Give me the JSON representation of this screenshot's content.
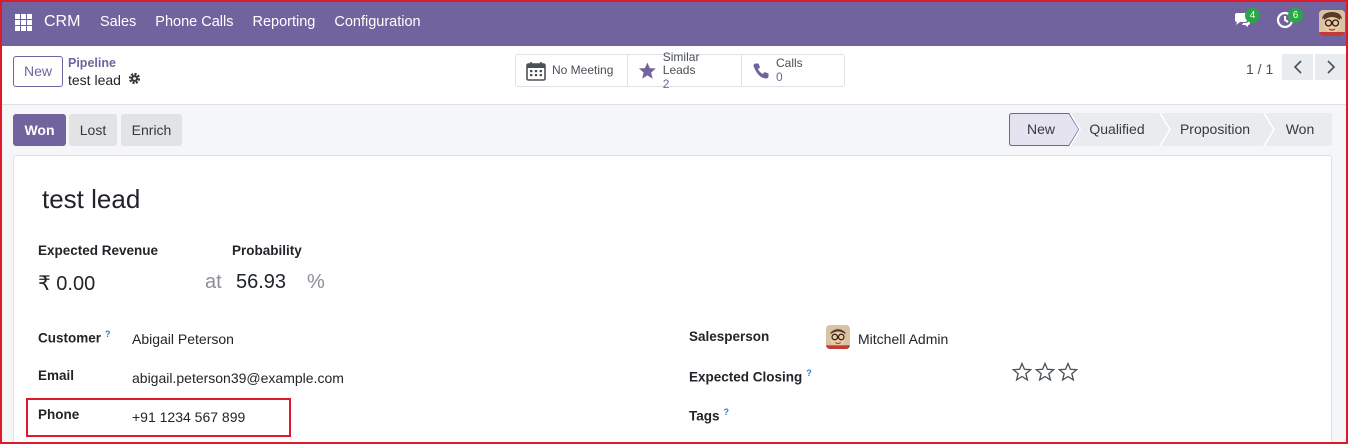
{
  "navbar": {
    "app_name": "CRM",
    "menu": [
      "Sales",
      "Phone Calls",
      "Reporting",
      "Configuration"
    ],
    "messages_badge": "4",
    "activities_badge": "6",
    "bg_color": "#71639e"
  },
  "control_panel": {
    "new_button": "New",
    "breadcrumb_parent": "Pipeline",
    "breadcrumb_current": "test lead",
    "smart_buttons": {
      "meeting": "No Meeting",
      "similar_label": "Similar Leads",
      "similar_count": "2",
      "calls_label": "Calls",
      "calls_count": "0"
    },
    "pager": "1 / 1"
  },
  "status_bar": {
    "actions": {
      "won": "Won",
      "lost": "Lost",
      "enrich": "Enrich"
    },
    "stages": [
      "New",
      "Qualified",
      "Proposition",
      "Won"
    ],
    "active_stage": "New"
  },
  "form": {
    "title": "test lead",
    "expected_revenue_label": "Expected Revenue",
    "expected_revenue": "₹ 0.00",
    "at": "at",
    "probability_label": "Probability",
    "probability": "56.93",
    "percent": "%",
    "customer_label": "Customer",
    "customer": "Abigail Peterson",
    "email_label": "Email",
    "email": "abigail.peterson39@example.com",
    "phone_label": "Phone",
    "phone": "+91 1234 567 899",
    "salesperson_label": "Salesperson",
    "salesperson": "Mitchell Admin",
    "expected_closing_label": "Expected Closing",
    "tags_label": "Tags",
    "help_mark": "?"
  }
}
